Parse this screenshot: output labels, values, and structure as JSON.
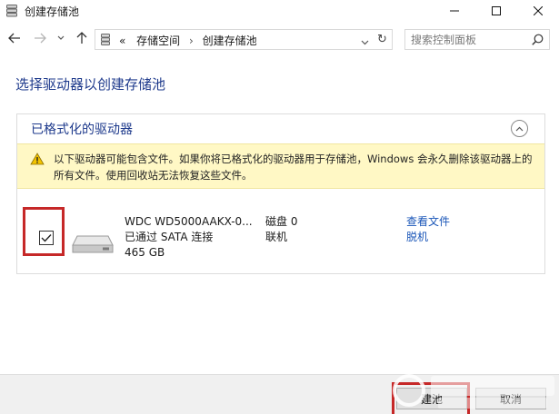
{
  "window": {
    "title": "创建存储池"
  },
  "nav": {
    "breadcrumb_prefix": "«",
    "breadcrumb": [
      "存储空间",
      "创建存储池"
    ],
    "breadcrumb_sep": "›",
    "search_placeholder": "搜索控制面板"
  },
  "main": {
    "heading": "选择驱动器以创建存储池",
    "panel_title": "已格式化的驱动器",
    "warning_text": "以下驱动器可能包含文件。如果你将已格式化的驱动器用于存储池，Windows 会永久删除该驱动器上的所有文件。使用回收站无法恢复这些文件。",
    "drive": {
      "checked": true,
      "name": "WDC WD5000AAKX-0...",
      "connection": "已通过 SATA 连接",
      "size": "465 GB",
      "disk": "磁盘 0",
      "status": "联机",
      "view_files_link": "查看文件",
      "offline_link": "脱机"
    }
  },
  "footer": {
    "create_label": "创建池",
    "create_label_visible": "建池",
    "cancel_label": "取消"
  },
  "colors": {
    "heading": "#1e3a8c",
    "link": "#1a56b8",
    "warning_bg": "#fff8c5",
    "highlight": "#c62828"
  }
}
